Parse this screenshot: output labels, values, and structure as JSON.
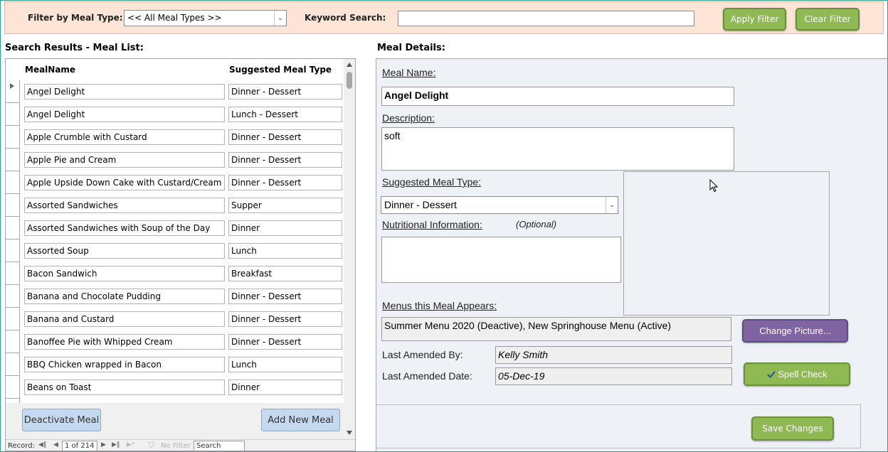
{
  "filter": {
    "meal_type_label": "Filter by Meal Type:",
    "meal_type_value": "<< All Meal Types >>",
    "keyword_label": "Keyword Search:",
    "keyword_value": "",
    "apply_label": "Apply Filter",
    "clear_label": "Clear Filter"
  },
  "list": {
    "title": "Search Results - Meal List:",
    "col_name": "MealName",
    "col_type": "Suggested Meal Type",
    "rows": [
      {
        "name": "Angel Delight",
        "type": "Dinner - Dessert"
      },
      {
        "name": "Angel Delight",
        "type": "Lunch - Dessert"
      },
      {
        "name": "Apple Crumble with Custard",
        "type": "Dinner - Dessert"
      },
      {
        "name": "Apple Pie and Cream",
        "type": "Dinner - Dessert"
      },
      {
        "name": "Apple Upside Down Cake with Custard/Cream",
        "type": "Dinner - Dessert"
      },
      {
        "name": "Assorted Sandwiches",
        "type": "Supper"
      },
      {
        "name": "Assorted Sandwiches with Soup of the Day",
        "type": "Dinner"
      },
      {
        "name": "Assorted Soup",
        "type": "Lunch"
      },
      {
        "name": "Bacon Sandwich",
        "type": "Breakfast"
      },
      {
        "name": "Banana and Chocolate Pudding",
        "type": "Dinner - Dessert"
      },
      {
        "name": "Banana and Custard",
        "type": "Dinner - Dessert"
      },
      {
        "name": "Banoffee Pie with Whipped Cream",
        "type": "Dinner - Dessert"
      },
      {
        "name": "BBQ Chicken wrapped in Bacon",
        "type": "Lunch"
      },
      {
        "name": "Beans on Toast",
        "type": "Dinner"
      }
    ],
    "deactivate_label": "Deactivate Meal",
    "add_label": "Add New Meal"
  },
  "nav": {
    "record_label": "Record:",
    "position": "1 of 214",
    "no_filter": "No Filter",
    "search": "Search"
  },
  "details": {
    "title": "Meal Details:",
    "name_label": "Meal Name:",
    "name_value": "Angel Delight",
    "desc_label": "Description:",
    "desc_value": "soft",
    "type_label": "Suggested Meal Type:",
    "type_value": "Dinner - Dessert",
    "nutrition_label": "Nutritional Information:",
    "optional_label": "(Optional)",
    "nutrition_value": "",
    "menus_label": "Menus this Meal Appears:",
    "menus_value": "Summer Menu 2020 (Deactive), New Springhouse Menu (Active)",
    "change_picture_label": "Change Picture...",
    "amended_by_label": "Last Amended By:",
    "amended_by_value": "Kelly Smith",
    "amended_date_label": "Last Amended Date:",
    "amended_date_value": "05-Dec-19",
    "spell_check_label": "Spell Check",
    "save_label": "Save Changes"
  },
  "colors": {
    "filter_bg": "#fce4d6",
    "green_button": "#8fba53",
    "purple_button": "#8064a2",
    "blue_button": "#c5d9f1",
    "panel_bg": "#eef2f7"
  }
}
